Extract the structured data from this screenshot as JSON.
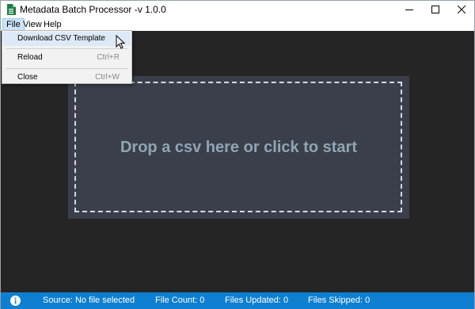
{
  "window": {
    "title": "Metadata Batch Processor -v 1.0.0",
    "icon": "spreadsheet-icon",
    "controls": [
      "minimize-icon",
      "maximize-icon",
      "close-icon"
    ]
  },
  "menubar": {
    "items": [
      {
        "label": "File",
        "active": true
      },
      {
        "label": "View"
      },
      {
        "label": "Help"
      }
    ]
  },
  "file_menu": {
    "items": [
      {
        "label": "Download CSV Template",
        "shortcut": "",
        "highlighted": true
      },
      {
        "label": "Reload",
        "shortcut": "Ctrl+R"
      },
      {
        "label": "Close",
        "shortcut": "Ctrl+W"
      }
    ]
  },
  "dropzone": {
    "text": "Drop a csv here or click to start"
  },
  "statusbar": {
    "icon": "info-icon",
    "source": "Source: No file selected",
    "file_count": "File Count: 0",
    "files_updated": "Files Updated: 0",
    "files_skipped": "Files Skipped: 0"
  },
  "colors": {
    "background": "#252526",
    "dropzone": "#3a3f4b",
    "dropzone_text": "#8fa6b2",
    "statusbar": "#0e7fd1",
    "menu_highlight": "#dde9f6"
  }
}
